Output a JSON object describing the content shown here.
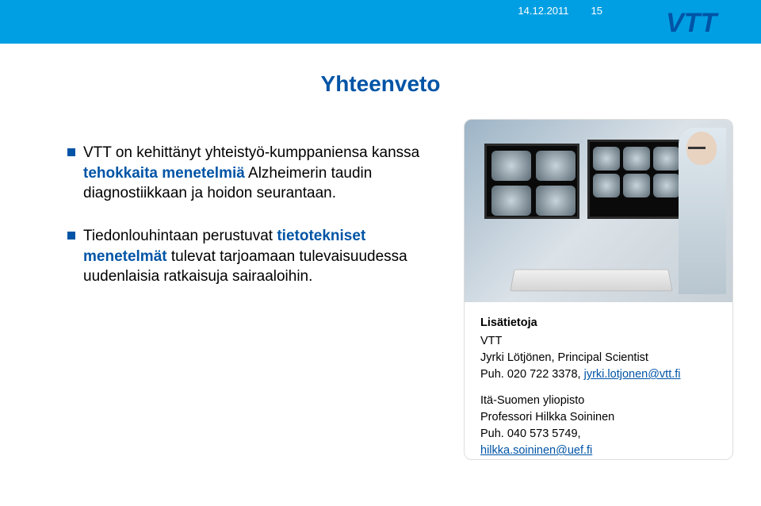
{
  "meta": {
    "date": "14.12.2011",
    "page_number": "15",
    "logo_alt": "VTT"
  },
  "title": "Yhteenveto",
  "bullets": [
    {
      "parts": [
        {
          "text": "VTT on kehittänyt yhteistyö-kumppaniensa kanssa "
        },
        {
          "text": "tehokkaita menetelmiä",
          "hl": true
        },
        {
          "text": " Alzheimerin taudin diagnostiikkaan ja hoidon seurantaan."
        }
      ]
    },
    {
      "parts": [
        {
          "text": "Tiedonlouhintaan perustuvat "
        },
        {
          "text": "tietotekniset menetelmät",
          "hl": true
        },
        {
          "text": " tulevat tarjoamaan tulevaisuudessa uudenlaisia ratkaisuja sairaaloihin."
        }
      ]
    }
  ],
  "contact": {
    "heading": "Lisätietoja",
    "org1": "VTT",
    "person1": "Jyrki Lötjönen, Principal Scientist",
    "phone1_prefix": "Puh. 020 722 3378, ",
    "email1": "jyrki.lotjonen@vtt.fi",
    "org2": "Itä-Suomen yliopisto",
    "person2": "Professori Hilkka Soininen",
    "phone2_line": "Puh. 040 573 5749,",
    "email2": "hilkka.soininen@uef.fi"
  }
}
